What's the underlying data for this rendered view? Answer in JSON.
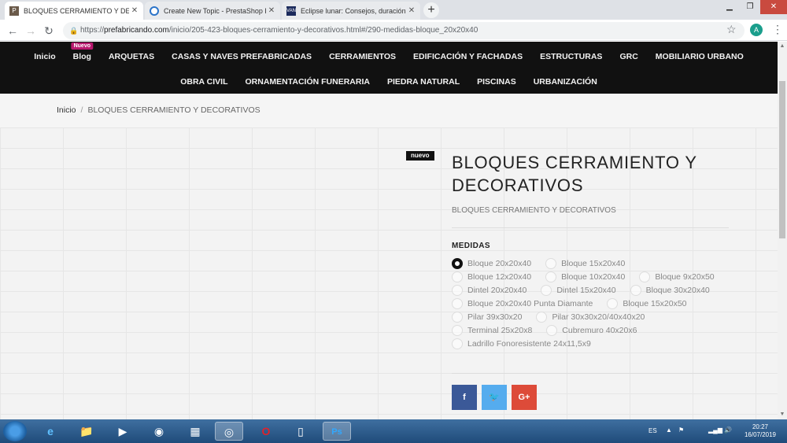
{
  "browser": {
    "tabs": [
      {
        "title": "BLOQUES CERRAMIENTO Y DECORATIVOS",
        "favicon": "prefabricando-logo-icon",
        "active": true
      },
      {
        "title": "Create New Topic - PrestaShop F",
        "favicon": "prestashop-logo-icon",
        "active": false
      },
      {
        "title": "Eclipse lunar: Consejos, duración",
        "favicon": "van-logo-icon",
        "active": false
      }
    ],
    "url_host": "prefabricando.com",
    "url_path": "/inicio/205-423-bloques-cerramiento-y-decorativos.html#/290-medidas-bloque_20x20x40",
    "url_prefix": "https://",
    "profile_initial": "A"
  },
  "nav": {
    "row1": [
      "Inicio",
      "Blog",
      "ARQUETAS",
      "CASAS Y NAVES PREFABRICADAS",
      "CERRAMIENTOS",
      "EDIFICACIÓN Y FACHADAS",
      "ESTRUCTURAS",
      "GRC",
      "MOBILIARIO URBANO"
    ],
    "row2": [
      "OBRA CIVIL",
      "ORNAMENTACIÓN FUNERARIA",
      "PIEDRA NATURAL",
      "PISCINAS",
      "URBANIZACIÓN"
    ],
    "blog_badge": "Nuevo"
  },
  "breadcrumb": {
    "home": "Inicio",
    "separator": "/",
    "current": "BLOQUES CERRAMIENTO Y DECORATIVOS"
  },
  "product": {
    "new_flag": "nuevo",
    "title": "BLOQUES CERRAMIENTO Y DECORATIVOS",
    "subtitle": "BLOQUES CERRAMIENTO Y DECORATIVOS",
    "medidas_label": "MEDIDAS",
    "options": [
      [
        "Bloque 20x20x40",
        "Bloque 15x20x40"
      ],
      [
        "Bloque 12x20x40",
        "Bloque 10x20x40",
        "Bloque 9x20x50"
      ],
      [
        "Dintel 20x20x40",
        "Dintel 15x20x40",
        "Bloque 30x20x40"
      ],
      [
        "Bloque 20x20x40 Punta Diamante",
        "Bloque 15x20x50"
      ],
      [
        "Pilar 39x30x20",
        "Pilar 30x30x20/40x40x20"
      ],
      [
        "Terminal 25x20x8",
        "Cubremuro 40x20x6"
      ],
      [
        "Ladrillo Fonoresistente 24x11,5x9"
      ]
    ],
    "selected_option": "Bloque 20x20x40",
    "social": [
      {
        "label": "f",
        "color": "#3b5998",
        "name": "facebook-share-button"
      },
      {
        "label": "🐦",
        "color": "#55acee",
        "name": "twitter-share-button"
      },
      {
        "label": "G+",
        "color": "#dd4b39",
        "name": "googleplus-share-button"
      }
    ]
  },
  "taskbar": {
    "lang": "ES",
    "time": "20:27",
    "date": "16/07/2019"
  }
}
